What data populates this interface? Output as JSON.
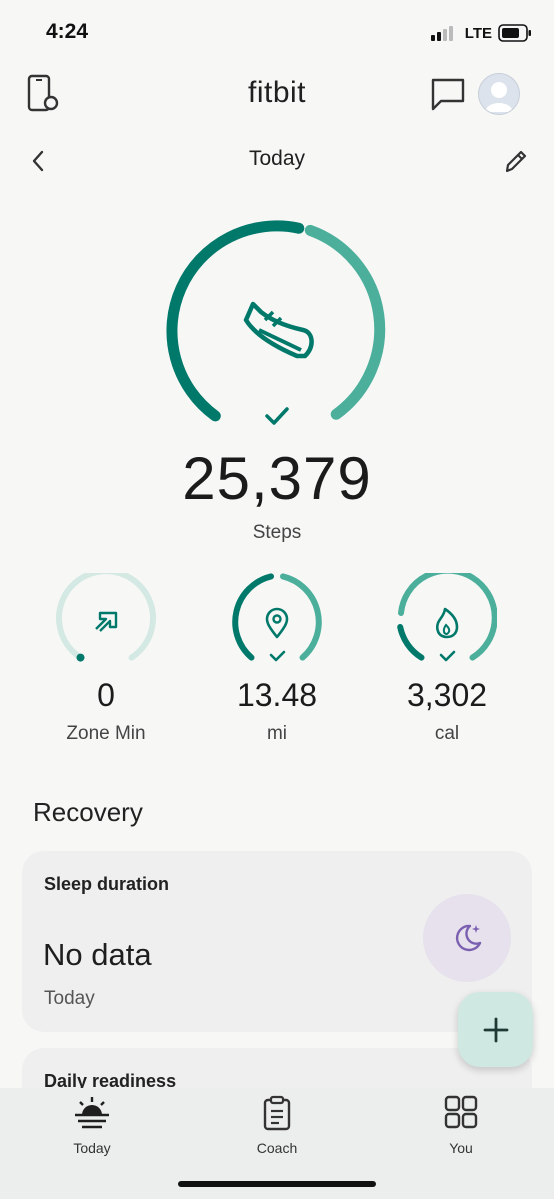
{
  "status_bar": {
    "time": "4:24",
    "network": "LTE"
  },
  "header": {
    "app_title": "fitbit"
  },
  "date_nav": {
    "title": "Today"
  },
  "steps": {
    "value": "25,379",
    "label": "Steps",
    "goal_progress": 1.0
  },
  "metrics": [
    {
      "value": "0",
      "label": "Zone Min",
      "progress": 0.0,
      "icon": "zone-arrows-icon"
    },
    {
      "value": "13.48",
      "label": "mi",
      "progress": 1.0,
      "icon": "location-pin-icon"
    },
    {
      "value": "3,302",
      "label": "cal",
      "progress": 1.0,
      "icon": "flame-icon"
    }
  ],
  "recovery": {
    "title": "Recovery",
    "sleep_card": {
      "title": "Sleep duration",
      "value": "No data",
      "subtitle": "Today"
    },
    "readiness_card": {
      "title": "Daily readiness"
    }
  },
  "bottom_nav": [
    {
      "label": "Today",
      "icon": "sunrise-icon",
      "active": true
    },
    {
      "label": "Coach",
      "icon": "clipboard-icon",
      "active": false
    },
    {
      "label": "You",
      "icon": "grid-icon",
      "active": false
    }
  ],
  "colors": {
    "accent": "#00796b",
    "accent_light": "#4caf9c",
    "track_light": "#d4e9e3",
    "moon": "#7b5fb0"
  }
}
